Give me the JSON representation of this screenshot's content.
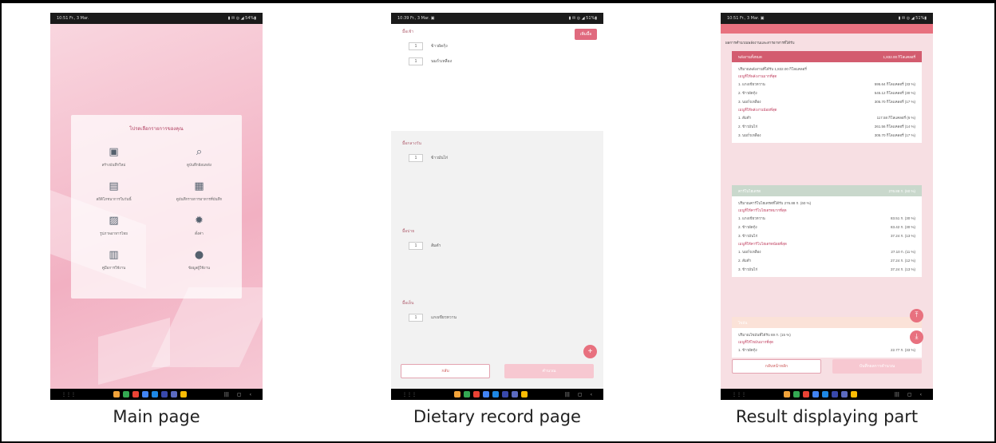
{
  "captions": [
    "Main page",
    "Dietary record page",
    "Result displaying part"
  ],
  "status": {
    "p1": {
      "left": "10:51  Fr., 3 Mar.",
      "right": "▮ ✉ ◎ ◢ 54%▮"
    },
    "p2": {
      "left": "10:39  Fr., 3 Mar.  ▣",
      "right": "▮ ✉ ◎ ◢ 51%▮"
    },
    "p3": {
      "left": "10:51  Fr., 3 Mar.  ▣",
      "right": "▮ ✉ ◎ ◢ 51%▮"
    }
  },
  "main_page": {
    "menu_title": "โปรดเลือกรายการของคุณ",
    "items": [
      {
        "icon": "add-document-icon",
        "glyph": "▣",
        "label": "สร้างบันทึกใหม่"
      },
      {
        "icon": "search-document-icon",
        "glyph": "⌕",
        "label": "ดูบันทึกย้อนหลัง"
      },
      {
        "icon": "clipboard-icon",
        "glyph": "▤",
        "label": "สถิติโภชนาการในวันนี้"
      },
      {
        "icon": "list-icon",
        "glyph": "▦",
        "label": "ดูบันทึกรายการอาหารที่บันทึก"
      },
      {
        "icon": "image-icon",
        "glyph": "▨",
        "label": "รูปภาพอาหารไทย"
      },
      {
        "icon": "gear-icon",
        "glyph": "✹",
        "label": "ตั้งค่า"
      },
      {
        "icon": "book-icon",
        "glyph": "▥",
        "label": "คู่มือการใช้งาน"
      },
      {
        "icon": "account-icon",
        "glyph": "●",
        "label": "ข้อมูลผู้ใช้งาน"
      }
    ]
  },
  "dietary_page": {
    "add_label": "เพิ่มมื้อ",
    "sections": [
      {
        "label": "มื้อเช้า",
        "rows": [
          {
            "qty": "1",
            "food": "ข้าวผัดกุ้ง"
          },
          {
            "qty": "1",
            "food": "นมถั่วเหลือง"
          }
        ]
      },
      {
        "label": "มื้อกลางวัน",
        "rows": [
          {
            "qty": "1",
            "food": "ข้าวมันไก่"
          }
        ]
      },
      {
        "label": "มื้อบ่าย",
        "rows": [
          {
            "qty": "1",
            "food": "ส้มตำ"
          }
        ]
      },
      {
        "label": "มื้อเย็น",
        "rows": [
          {
            "qty": "1",
            "food": "แกงเขียวหวาน"
          }
        ]
      }
    ],
    "fab": "+",
    "back_label": "กลับ",
    "calc_label": "คำนวณ"
  },
  "result_page": {
    "heading": "ผลการคำนวณพลังงานและสารอาหารที่ได้รับ",
    "cards": [
      {
        "title": "พลังงานทั้งหมด",
        "value": "1,832.00 กิโลแคลอรี่",
        "color": "#d35c6f",
        "lines": [
          {
            "t": "sub",
            "a": "ปริมาณพลังงานที่ได้รับ 1,832.00 กิโลแคลอรี่"
          },
          {
            "t": "sub2",
            "a": "เมนูที่ให้พลังงานมากที่สุด"
          },
          {
            "t": "line",
            "a": "1. แกงเขียวหวาน",
            "b": "595.64 กิโลแคลอรี่ (33 %)"
          },
          {
            "t": "line",
            "a": "2. ข้าวผัดกุ้ง",
            "b": "545.12 กิโลแคลอรี่ (30 %)"
          },
          {
            "t": "line",
            "a": "3. นมถั่วเหลือง",
            "b": "305.70 กิโลแคลอรี่ (17 %)"
          },
          {
            "t": "sub2",
            "a": "เมนูที่ให้พลังงานน้อยที่สุด"
          },
          {
            "t": "line",
            "a": "1. ส้มตำ",
            "b": "117.58 กิโลแคลอรี่ (6 %)"
          },
          {
            "t": "line",
            "a": "2. ข้าวมันไก่",
            "b": "261.56 กิโลแคลอรี่ (14 %)"
          },
          {
            "t": "line",
            "a": "3. นมถั่วเหลือง",
            "b": "305.70 กิโลแคลอรี่ (17 %)"
          }
        ]
      },
      {
        "title": "คาร์โบไฮเดรต",
        "value": "276.88 ก. (60 %)",
        "color": "#c9d8cc",
        "lines": [
          {
            "t": "sub",
            "a": "ปริมาณคาร์โบไฮเดรตที่ได้รับ 276.88 ก. (60 %)"
          },
          {
            "t": "sub2",
            "a": "เมนูที่ให้คาร์โบไฮเดรตมากที่สุด"
          },
          {
            "t": "line",
            "a": "1. แกงเขียวหวาน",
            "b": "83.51 ก. (30 %)"
          },
          {
            "t": "line",
            "a": "2. ข้าวผัดกุ้ง",
            "b": "83.42 ก. (30 %)"
          },
          {
            "t": "line",
            "a": "3. ข้าวมันไก่",
            "b": "37.24 ก. (13 %)"
          },
          {
            "t": "sub2",
            "a": "เมนูที่ให้คาร์โบไฮเดรตน้อยที่สุด"
          },
          {
            "t": "line",
            "a": "1. นมถั่วเหลือง",
            "b": "27.10 ก. (11 %)"
          },
          {
            "t": "line",
            "a": "2. ส้มตำ",
            "b": "27.24 ก. (12 %)"
          },
          {
            "t": "line",
            "a": "3. ข้าวมันไก่",
            "b": "37.24 ก. (13 %)"
          }
        ]
      },
      {
        "title": "ไขมัน",
        "value": "",
        "color": "#fbe2d8",
        "lines": [
          {
            "t": "sub",
            "a": "ปริมาณไขมันที่ได้รับ 69 ก. (15 %)"
          },
          {
            "t": "sub2",
            "a": "เมนูที่ให้ไขมันมากที่สุด"
          },
          {
            "t": "line",
            "a": "1. ข้าวผัดกุ้ง",
            "b": "22.77 ก. (33 %)"
          }
        ]
      }
    ],
    "fab_up": "⤒",
    "fab_down": "⤓",
    "btn_a": "กลับหน้าหลัก",
    "btn_b": "บันทึกผลการคำนวณ"
  }
}
